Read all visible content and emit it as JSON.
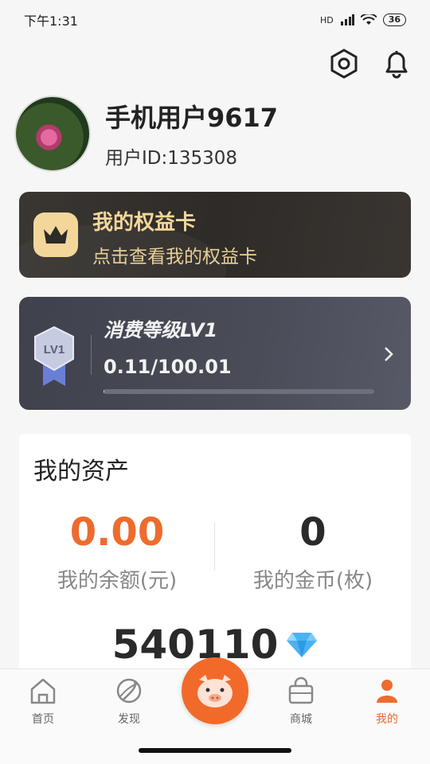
{
  "status_bar": {
    "time": "下午1:31",
    "signal": "HD",
    "battery": "36"
  },
  "profile": {
    "name": "手机用户9617",
    "user_id": "用户ID:135308"
  },
  "benefit_card": {
    "title": "我的权益卡",
    "subtitle": "点击查看我的权益卡",
    "color": "#f3d79a"
  },
  "level_card": {
    "badge": "LV1",
    "title": "消费等级LV1",
    "progress_text": "0.11/100.01",
    "progress_fraction": 0.0011
  },
  "assets": {
    "title": "我的资产",
    "balance": {
      "value": "0.00",
      "label": "我的余额(元)"
    },
    "coins": {
      "value": "0",
      "label": "我的金币(枚)"
    },
    "diamonds": {
      "value": "540110",
      "icon": "diamond-icon"
    }
  },
  "nav": {
    "items": [
      {
        "label": "首页",
        "icon": "home-icon"
      },
      {
        "label": "发现",
        "icon": "discover-icon"
      },
      {
        "label": "商城",
        "icon": "shop-icon"
      },
      {
        "label": "我的",
        "icon": "user-icon",
        "active": true
      }
    ],
    "accent": "#ee6b2e"
  }
}
